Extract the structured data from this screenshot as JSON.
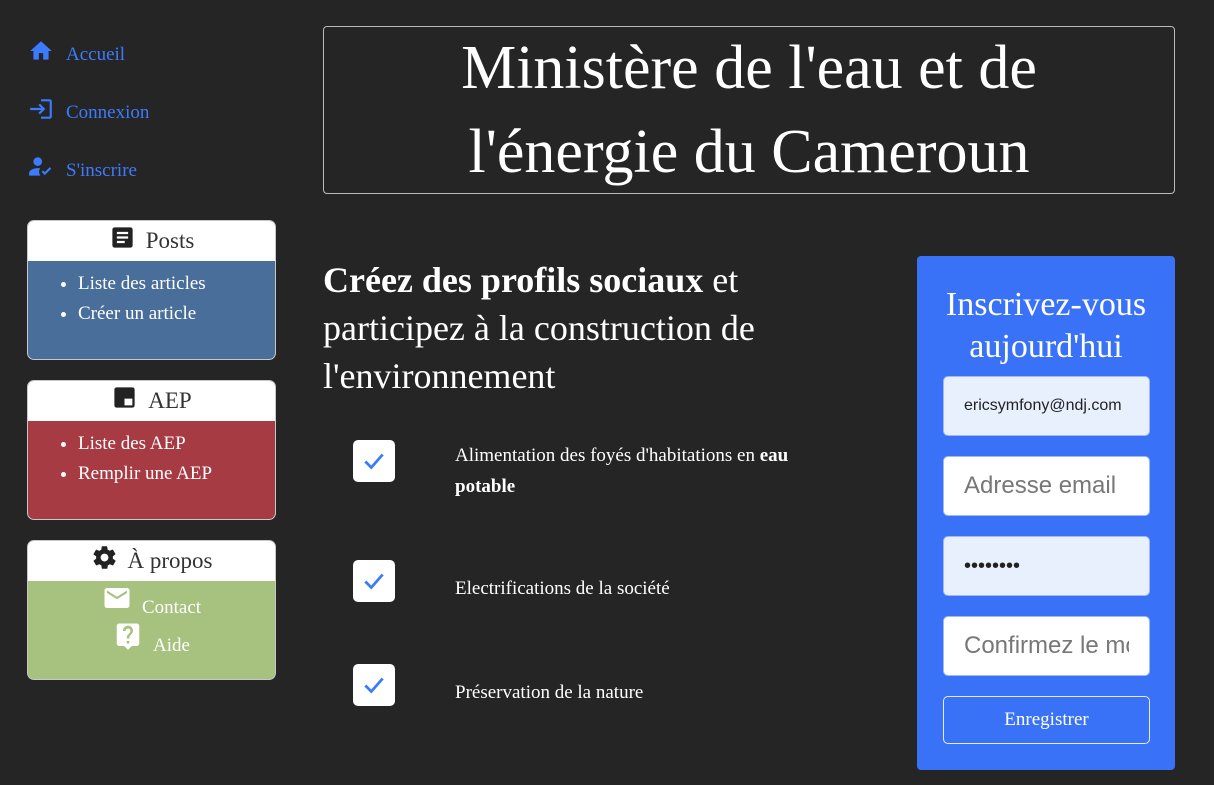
{
  "nav": {
    "items": [
      {
        "label": "Accueil",
        "icon": "home-icon"
      },
      {
        "label": "Connexion",
        "icon": "login-icon"
      },
      {
        "label": "S'inscrire",
        "icon": "user-check-icon"
      }
    ]
  },
  "cards": {
    "posts": {
      "title": "Posts",
      "icon": "article-icon",
      "color": "#4a6e9a",
      "items": [
        "Liste des articles",
        "Créer un article"
      ]
    },
    "aep": {
      "title": "AEP",
      "icon": "window-icon",
      "color": "#a63b44",
      "items": [
        "Liste des AEP",
        "Remplir une AEP"
      ]
    },
    "about": {
      "title": "À propos",
      "icon": "gear-icon",
      "color": "#a7c17e",
      "items": [
        {
          "label": "Contact",
          "icon": "mail-icon"
        },
        {
          "label": "Aide",
          "icon": "help-icon"
        }
      ]
    }
  },
  "header": {
    "line1": "Ministère de l'eau et de",
    "line2": "l'énergie du Cameroun"
  },
  "tagline": {
    "bold": "Créez des profils sociaux",
    "rest": " et participez à la construction de l'environnement"
  },
  "features": [
    {
      "text": "Alimentation des foyés d'habitations en ",
      "bold": "eau potable"
    },
    {
      "text": "Electrifications de la société",
      "bold": ""
    },
    {
      "text": "Préservation de la nature",
      "bold": ""
    }
  ],
  "form": {
    "title": "Inscrivez-vous aujourd'hui",
    "username_value": "ericsymfony@ndj.com",
    "email_placeholder": "Adresse email",
    "password_value": "••••••••",
    "confirm_placeholder": "Confirmez le mot de passe",
    "submit_label": "Enregistrer"
  },
  "colors": {
    "accent": "#3a72f7",
    "background": "#252525"
  }
}
